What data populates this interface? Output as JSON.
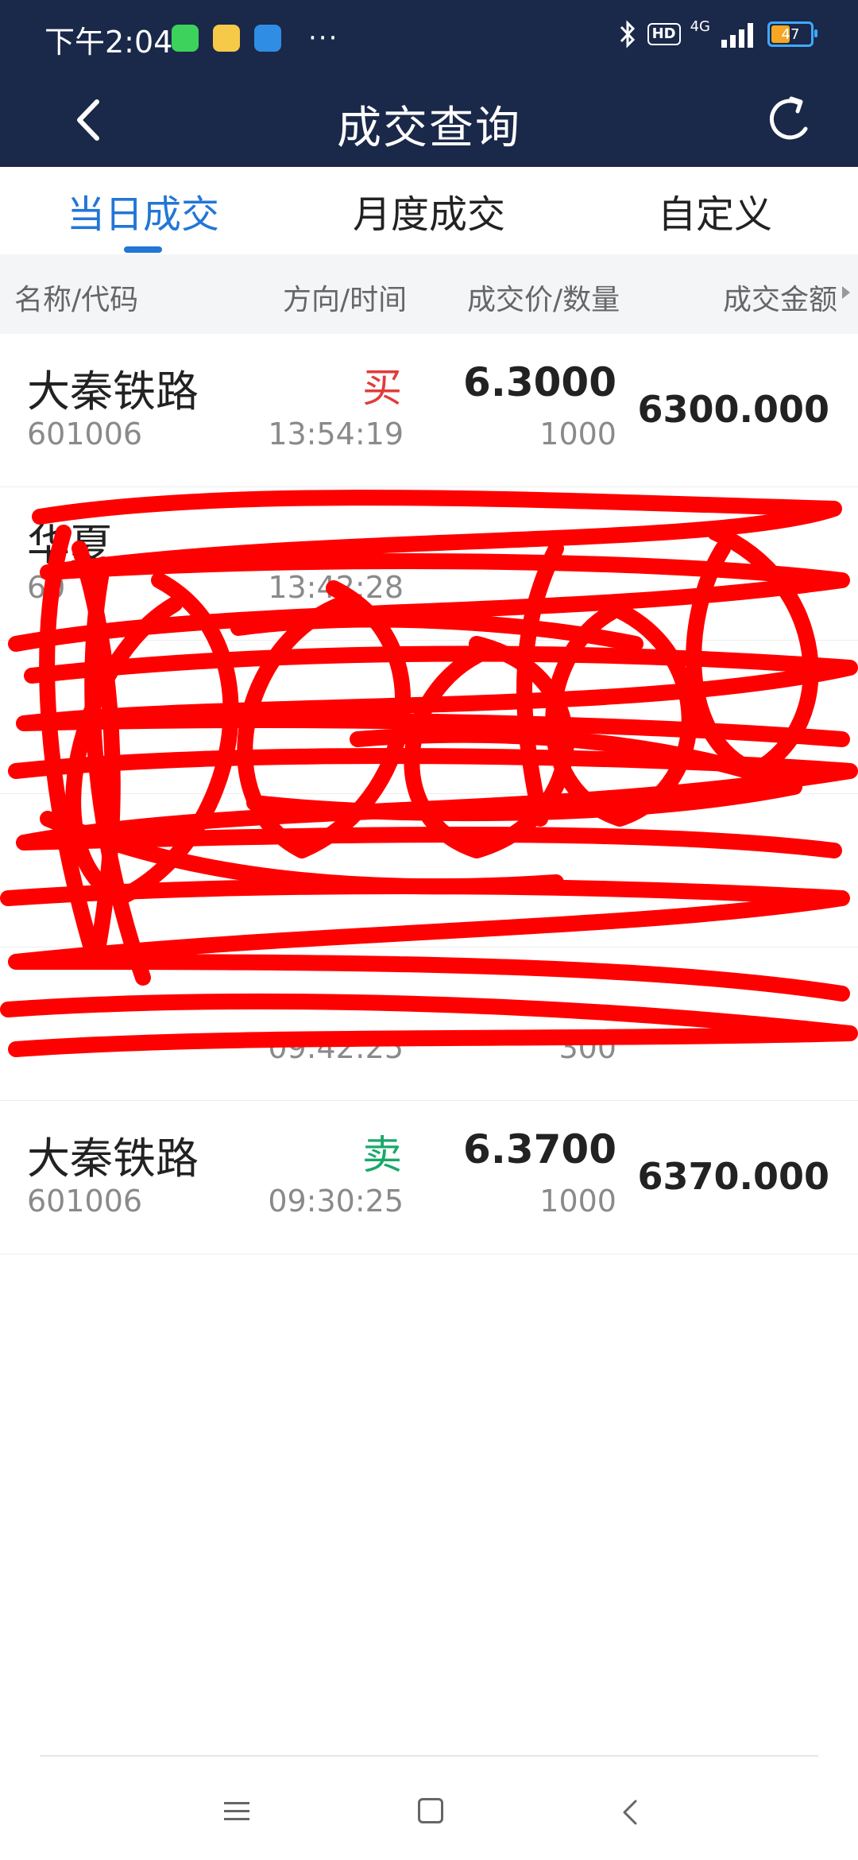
{
  "status_bar": {
    "time": "下午2:04",
    "app_icons": [
      "wechat-icon",
      "meituan-icon",
      "browser-icon"
    ],
    "more": "···",
    "network": "4G",
    "battery": "47",
    "colors": {
      "wechat": "#3dd25c",
      "meituan": "#f7c948",
      "browser": "#2f8de4"
    }
  },
  "header": {
    "title": "成交查询",
    "back_icon": "back-chevron-icon",
    "refresh_icon": "refresh-icon"
  },
  "tabs": [
    {
      "label": "当日成交",
      "active": true
    },
    {
      "label": "月度成交",
      "active": false
    },
    {
      "label": "自定义",
      "active": false
    }
  ],
  "columns": [
    "名称/代码",
    "方向/时间",
    "成交价/数量",
    "成交金额"
  ],
  "rows": [
    {
      "name": "大秦铁路",
      "code": "601006",
      "direction": "买",
      "time": "13:54:19",
      "price": "6.3000",
      "quantity": "1000",
      "amount": "6300.000"
    },
    {
      "name": "华夏",
      "code": "60",
      "direction": "",
      "time": "13:42:28",
      "price": "",
      "quantity": "",
      "amount": ""
    },
    {
      "name": "",
      "code": "",
      "direction": "",
      "time": "",
      "price": "",
      "quantity": "",
      "amount": ""
    },
    {
      "name": "",
      "code": "",
      "direction": "",
      "time": "",
      "price": "",
      "quantity": "",
      "amount": ""
    },
    {
      "name": "",
      "code": "",
      "direction": "",
      "time": "09:42:25",
      "price": "",
      "quantity": "300",
      "amount": ""
    },
    {
      "name": "大秦铁路",
      "code": "601006",
      "direction": "卖",
      "time": "09:30:25",
      "price": "6.3700",
      "quantity": "1000",
      "amount": "6370.000"
    }
  ],
  "colors": {
    "header_bg": "#1a2849",
    "accent": "#2276d6",
    "buy": "#e23b3b",
    "sell": "#19a86a",
    "scribble": "#ff0000"
  },
  "bottom_nav": {
    "icons": [
      "menu-icon",
      "home-icon",
      "back-icon"
    ]
  }
}
